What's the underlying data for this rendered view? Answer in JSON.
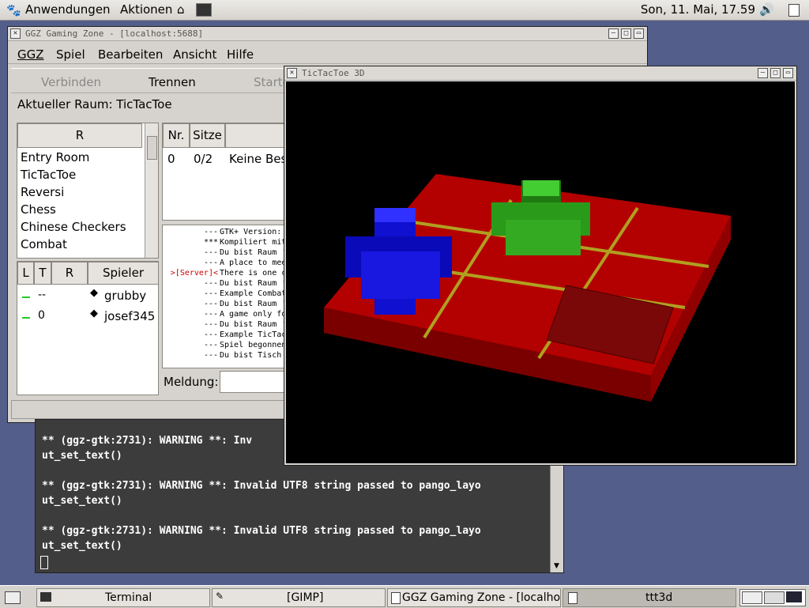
{
  "top_panel": {
    "apps_label": "Anwendungen",
    "actions_label": "Aktionen",
    "clock": "Son, 11. Mai, 17.59"
  },
  "ggz_window": {
    "title": "GGZ Gaming Zone - [localhost:5688]",
    "menu": [
      "GGZ",
      "Spiel",
      "Bearbeiten",
      "Ansicht",
      "Hilfe"
    ],
    "toolbar": {
      "connect": "Verbinden",
      "disconnect": "Trennen",
      "start": "Starte"
    },
    "current_room": "Aktueller Raum: TicTacToe",
    "rooms_header": "R",
    "rooms": [
      "Entry Room",
      "TicTacToe",
      "Reversi",
      "Chess",
      "Chinese Checkers",
      "Combat"
    ],
    "tables_headers": [
      "Nr.",
      "Sitze"
    ],
    "tables_row": {
      "nr": "0",
      "seats": "0/2",
      "desc": "Keine Bes"
    },
    "players_headers": [
      "L",
      "T",
      "R",
      "Spieler"
    ],
    "players": [
      {
        "t": "--",
        "name": "grubby"
      },
      {
        "t": "0",
        "name": "josef345"
      }
    ],
    "chat_log": [
      {
        "prefix": "---",
        "text": "GTK+ Version:"
      },
      {
        "prefix": "***",
        "text": "Kompiliert mit"
      },
      {
        "prefix": "---",
        "text": "Du bist Raum '"
      },
      {
        "prefix": "---",
        "text": "A place to mee"
      },
      {
        "prefix": ">[Server]<",
        "text": "There is one c"
      },
      {
        "prefix": "---",
        "text": "Du bist Raum '"
      },
      {
        "prefix": "---",
        "text": "Example Combat"
      },
      {
        "prefix": "---",
        "text": "Du bist Raum '"
      },
      {
        "prefix": "---",
        "text": "A game only fo"
      },
      {
        "prefix": "---",
        "text": "Du bist Raum '"
      },
      {
        "prefix": "---",
        "text": "Example TicTac"
      },
      {
        "prefix": "---",
        "text": "Spiel begonnen"
      },
      {
        "prefix": "---",
        "text": "Du bist Tisch"
      }
    ],
    "message_label": "Meldung:"
  },
  "ttt_window": {
    "title": "TicTacToe 3D"
  },
  "terminal": {
    "lines": [
      "** (ggz-gtk:2731): WARNING **: Inv",
      "ut_set_text()",
      "",
      "** (ggz-gtk:2731): WARNING **: Invalid UTF8 string passed to pango_layo",
      "ut_set_text()",
      "",
      "** (ggz-gtk:2731): WARNING **: Invalid UTF8 string passed to pango_layo",
      "ut_set_text()"
    ]
  },
  "taskbar": {
    "items": [
      "Terminal",
      "[GIMP]",
      "GGZ Gaming Zone - [localho",
      "ttt3d"
    ]
  },
  "colors": {
    "desktop": "#545e8a",
    "board_red": "#b30000",
    "cross_green": "#2a9a1a",
    "circle_blue": "#1010d0",
    "grid_line": "#b0a020"
  }
}
